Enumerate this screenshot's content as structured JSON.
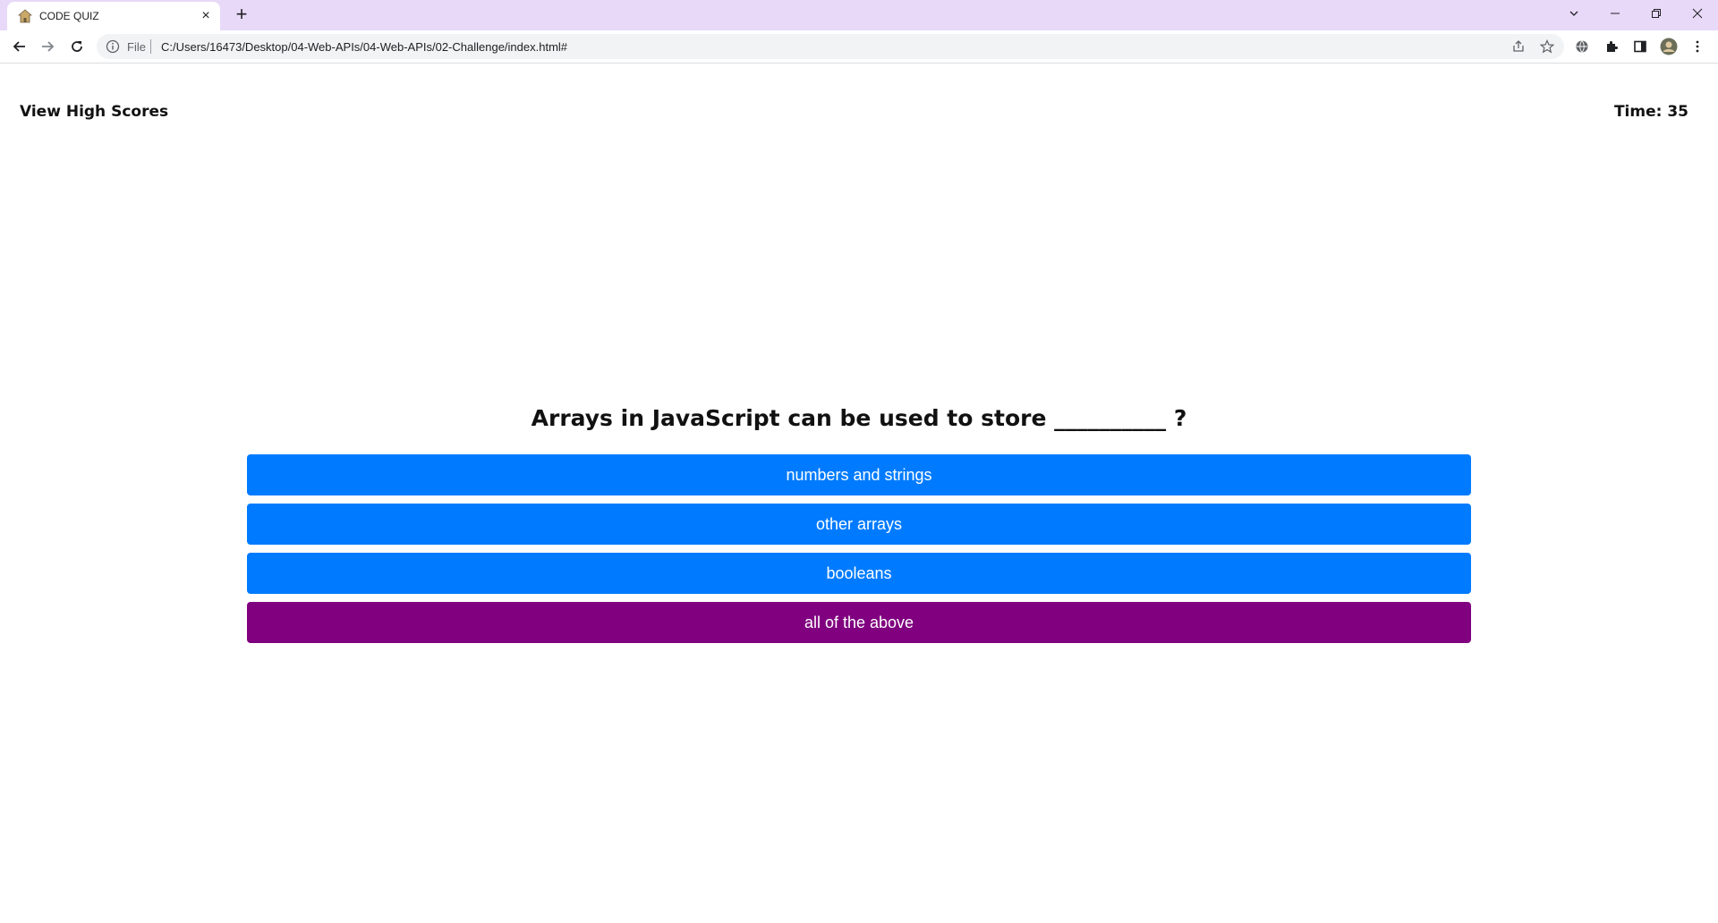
{
  "browser": {
    "tab_title": "CODE QUIZ",
    "close_tab_glyph": "×",
    "new_tab_glyph": "+",
    "omnibox": {
      "scheme_label": "File",
      "url": "C:/Users/16473/Desktop/04-Web-APIs/04-Web-APIs/02-Challenge/index.html#"
    }
  },
  "header": {
    "high_scores_label": "View High Scores",
    "timer_label": "Time: 35"
  },
  "quiz": {
    "question": "Arrays in JavaScript can be used to store __________ ?",
    "answers": [
      {
        "label": "numbers and strings"
      },
      {
        "label": "other arrays"
      },
      {
        "label": "booleans"
      },
      {
        "label": "all of the above"
      }
    ],
    "selected_answer": "all of the above"
  },
  "colors": {
    "tabstrip": "#e8d9f8",
    "answer_default": "#007bff",
    "answer_selected": "#800080"
  }
}
